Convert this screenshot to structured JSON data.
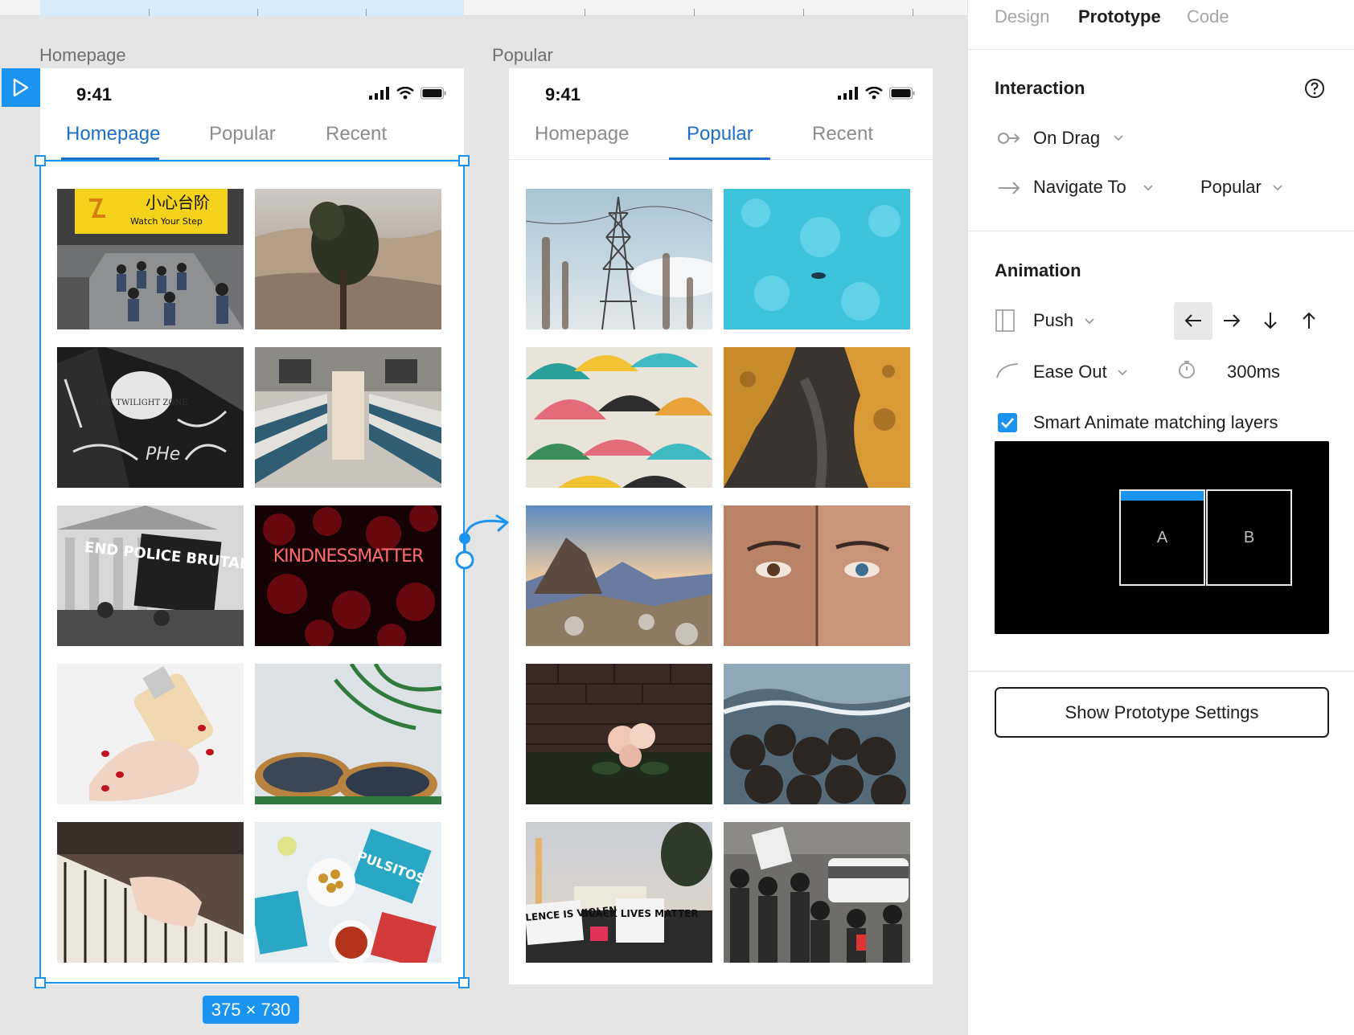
{
  "frames": {
    "a": {
      "label": "Homepage",
      "time": "9:41",
      "tabs": [
        "Homepage",
        "Popular",
        "Recent"
      ],
      "active_tab": "Homepage"
    },
    "b": {
      "label": "Popular",
      "time": "9:41",
      "tabs": [
        "Homepage",
        "Popular",
        "Recent"
      ],
      "active_tab": "Popular"
    },
    "selection_size": "375 × 730"
  },
  "photo_text": {
    "sign_cn": "小心台阶",
    "sign_en": "Watch Your Step",
    "twilight": "THE TWILIGHT ZONE",
    "protest": "END POLICE BRUTALITY",
    "neon": "KINDNESSMATTER",
    "blm": "BLACK LIVES MATTER",
    "white_silence": "WHITE SILENCE IS VIOLENCE",
    "pulsitos": "PULSITOS"
  },
  "panel": {
    "tabs": [
      "Design",
      "Prototype",
      "Code"
    ],
    "active_tab": "Prototype",
    "interaction": {
      "title": "Interaction",
      "trigger": "On Drag",
      "action": "Navigate To",
      "destination": "Popular"
    },
    "animation": {
      "title": "Animation",
      "type": "Push",
      "direction": "left",
      "easing": "Ease Out",
      "duration": "300ms",
      "smart_animate_label": "Smart Animate matching layers",
      "smart_animate_checked": true,
      "preview_a": "A",
      "preview_b": "B"
    },
    "settings_button": "Show Prototype Settings"
  },
  "colors": {
    "accent": "#1a94f0",
    "tab_active": "#1b6fc9"
  }
}
